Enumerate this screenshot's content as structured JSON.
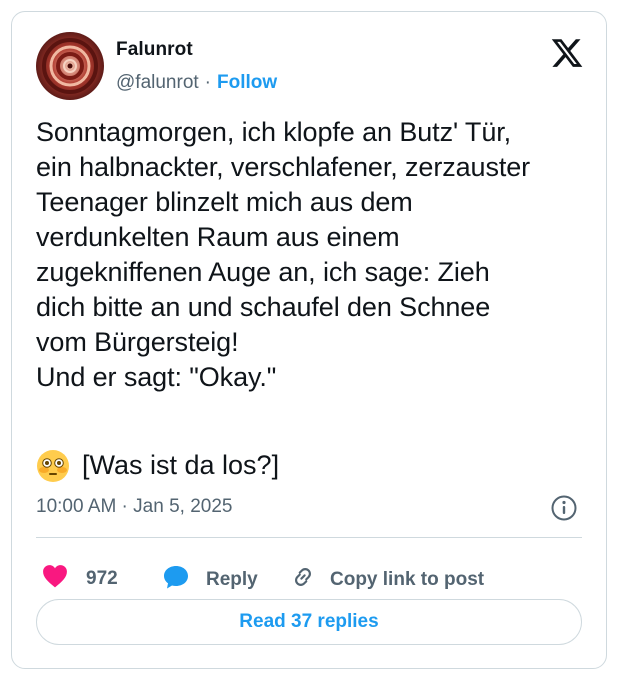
{
  "author": {
    "name": "Falunrot",
    "handle": "@falunrot",
    "separator": "·",
    "follow_label": "Follow"
  },
  "post": {
    "text": "Sonntagmorgen, ich klopfe an Butz' Tür,\nein halbnackter, verschlafener, zerzauster\nTeenager blinzelt mich aus dem\nverdunkelten Raum aus einem\nzugekniffenen Auge an, ich sage: Zieh\ndich bitte an und schaufel den Schnee\nvom Bürgersteig!\nUnd er sagt: \"Okay.\"",
    "emoji_line": "[Was ist da los?]",
    "emoji_icon": "flushed-face-icon",
    "timestamp": "10:00 AM · Jan 5, 2025"
  },
  "actions": {
    "like_count": "972",
    "reply_label": "Reply",
    "copy_label": "Copy link to post",
    "read_replies_label": "Read 37 replies"
  },
  "colors": {
    "accent": "#1d9bf0",
    "like": "#f91880",
    "muted": "#536471",
    "border": "#cfd9de"
  }
}
